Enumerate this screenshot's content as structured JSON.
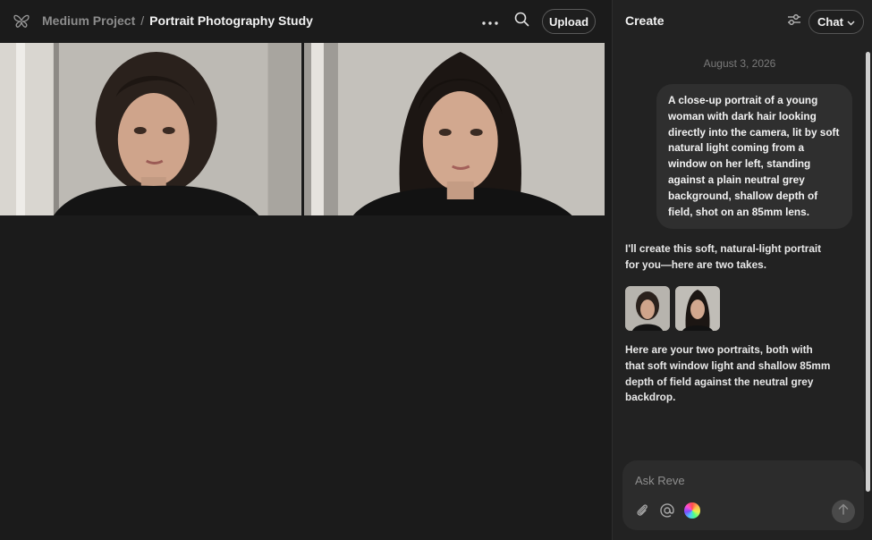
{
  "header": {
    "logo_icon": "butterfly-logo-icon",
    "project_name": "Medium Project",
    "separator": "/",
    "page_title": "Portrait Photography Study",
    "more_icon": "more-horizontal-icon",
    "search_icon": "search-icon",
    "upload_label": "Upload"
  },
  "gallery": {
    "images": [
      {
        "icon": "portrait-image-1"
      },
      {
        "icon": "portrait-image-2"
      }
    ]
  },
  "panel": {
    "title": "Create",
    "settings_icon": "sliders-icon",
    "mode_label": "Chat",
    "mode_icon": "chevron-down-icon"
  },
  "chat": {
    "date": "August 3, 2026",
    "user_message": "A close-up portrait of a young woman with dark hair looking directly into the camera, lit by soft natural light coming from a window on her left, standing against a plain neutral grey background, shallow depth of field, shot on an 85mm lens.",
    "assistant_intro": "I'll create this soft, natural-light portrait for you—here are two takes.",
    "assistant_outro": "Here are your two portraits, both with that soft window light and shallow 85mm depth of field against the neutral grey backdrop."
  },
  "composer": {
    "placeholder": "Ask Reve",
    "attach_icon": "paperclip-icon",
    "mention_icon": "at-sign-icon",
    "color_icon": "color-wheel-icon",
    "send_icon": "arrow-up-icon"
  },
  "colors": {
    "background": "#1b1b1b",
    "panel": "#222222",
    "bubble": "#2f2f2f",
    "composer": "#2c2c2c"
  }
}
